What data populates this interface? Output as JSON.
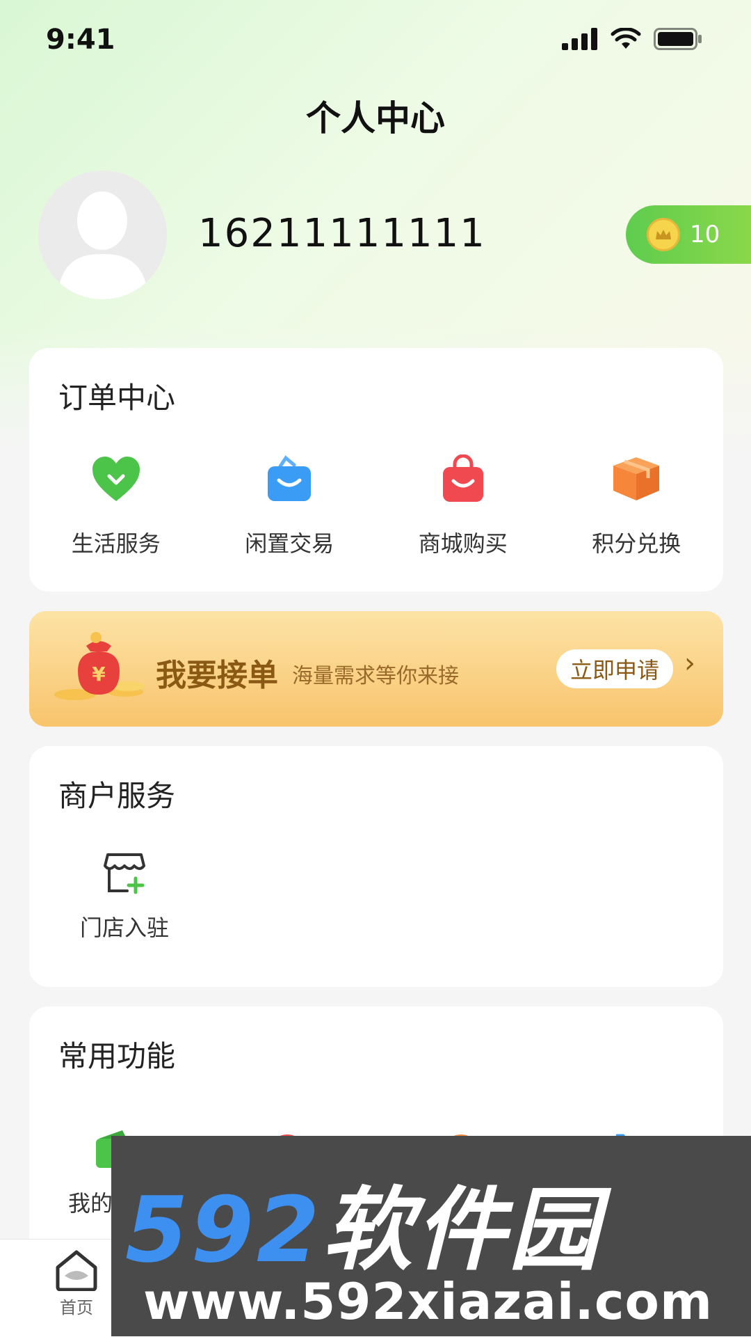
{
  "status": {
    "time": "9:41"
  },
  "header": {
    "title": "个人中心"
  },
  "profile": {
    "phone": "16211111111",
    "points": "10"
  },
  "orders": {
    "title": "订单中心",
    "items": [
      {
        "label": "生活服务",
        "icon": "heart-icon",
        "color": "#4cc44a"
      },
      {
        "label": "闲置交易",
        "icon": "shopping-bag-icon",
        "color": "#3b9cf5"
      },
      {
        "label": "商城购买",
        "icon": "shopping-bag-icon",
        "color": "#f0494f"
      },
      {
        "label": "积分兑换",
        "icon": "package-box-icon",
        "color": "#f5863a"
      }
    ]
  },
  "banner": {
    "title": "我要接单",
    "subtitle": "海量需求等你来接",
    "button": "立即申请",
    "arrow": "›"
  },
  "merchant": {
    "title": "商户服务",
    "items": [
      {
        "label": "门店入驻",
        "icon": "store-add-icon"
      }
    ]
  },
  "functions": {
    "title": "常用功能",
    "first_label_partial": "我的"
  },
  "tabbar": {
    "items": [
      {
        "label": "首页",
        "icon": "home-icon"
      }
    ]
  },
  "watermark": {
    "digits": "592",
    "name": "软件园",
    "url": "www.592xiazai.com"
  }
}
